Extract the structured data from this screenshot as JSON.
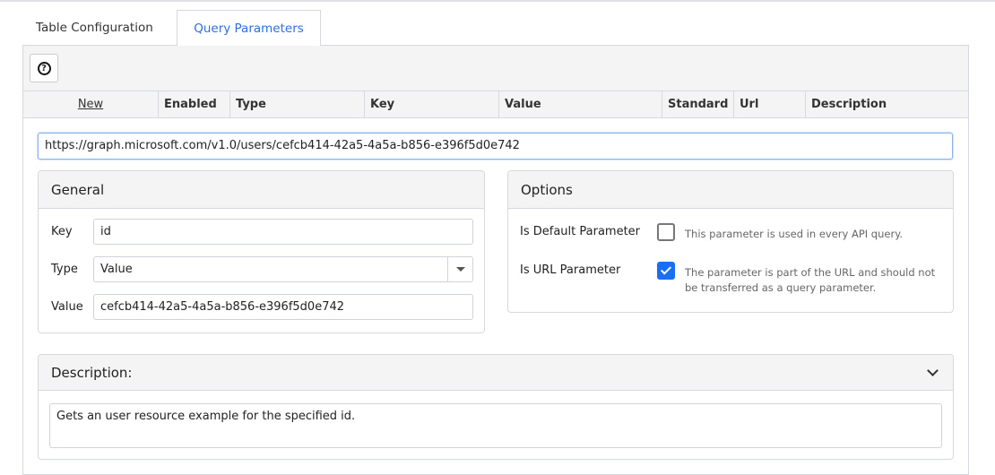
{
  "tabs": [
    {
      "label": "Table Configuration",
      "active": false
    },
    {
      "label": "Query Parameters",
      "active": true
    }
  ],
  "toolbar": {
    "help_icon": "question-circle-icon"
  },
  "columns": [
    "New",
    "Enabled",
    "Type",
    "Key",
    "Value",
    "Standard",
    "Url",
    "Description"
  ],
  "url": "https://graph.microsoft.com/v1.0/users/cefcb414-42a5-4a5a-b856-e396f5d0e742",
  "general": {
    "title": "General",
    "key_label": "Key",
    "key_value": "id",
    "type_label": "Type",
    "type_value": "Value",
    "value_label": "Value",
    "value_value": "cefcb414-42a5-4a5a-b856-e396f5d0e742"
  },
  "options": {
    "title": "Options",
    "default_label": "Is Default Parameter",
    "default_checked": false,
    "default_help": "This parameter is used in every API query.",
    "url_label": "Is URL Parameter",
    "url_checked": true,
    "url_help": "The parameter is part of the URL and should not be transferred as a query parameter."
  },
  "description": {
    "title": "Description:",
    "text": "Gets an user resource example for the specified id."
  },
  "colors": {
    "accent": "#2f6fe0",
    "checkbox": "#1a6ef5"
  }
}
